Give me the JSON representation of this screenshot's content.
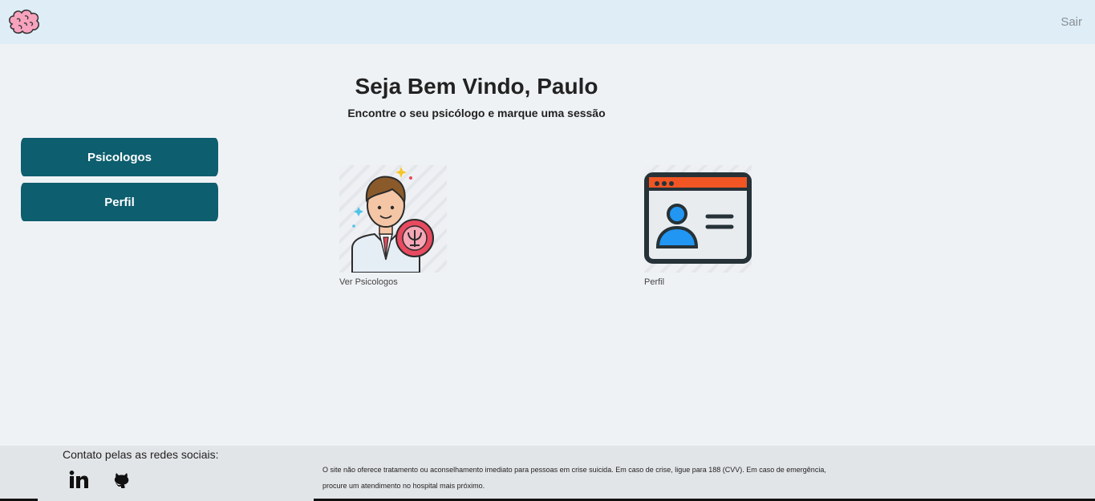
{
  "header": {
    "logo_icon": "brain-icon",
    "logout_label": "Sair",
    "background": "#deedf6"
  },
  "hero": {
    "title": "Seja Bem Vindo, Paulo",
    "subtitle": "Encontre o seu psicólogo e marque uma sessão"
  },
  "sidebar": {
    "items": [
      {
        "label": "Psicologos"
      },
      {
        "label": "Perfil"
      }
    ],
    "button_color": "#0d5e6e"
  },
  "cards": [
    {
      "caption": "Ver Psicologos",
      "icon": "psychologist-icon"
    },
    {
      "caption": "Perfil",
      "icon": "profile-card-icon"
    }
  ],
  "footer": {
    "contact_title": "Contato pelas as redes sociais:",
    "social": [
      "linkedin-icon",
      "github-icon"
    ],
    "disclaimer_line1": "O site não oferece tratamento ou aconselhamento imediato para pessoas em crise suicida. Em caso de crise, ligue para 188 (CVV). Em caso de emergência,",
    "disclaimer_line2": "procure um atendimento no hospital mais próximo."
  }
}
